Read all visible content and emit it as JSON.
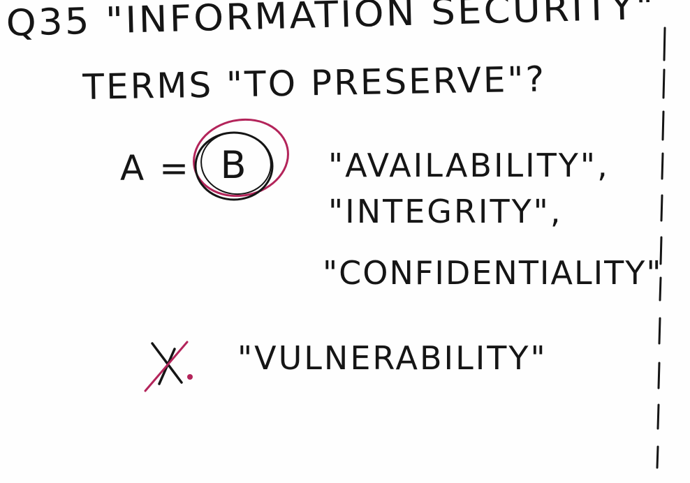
{
  "question": {
    "line1": "Q35 \"INFORMATION SECURITY\"",
    "line2": "TERMS \"TO PRESERVE\"?"
  },
  "answer": {
    "label": "A =",
    "letter": "B"
  },
  "options": [
    "\"AVAILABILITY\",",
    "\"INTEGRITY\",",
    "\"CONFIDENTIALITY\"",
    "\"VULNERABILITY\""
  ],
  "colors": {
    "ink": "#151515",
    "correction": "#b3245a"
  }
}
